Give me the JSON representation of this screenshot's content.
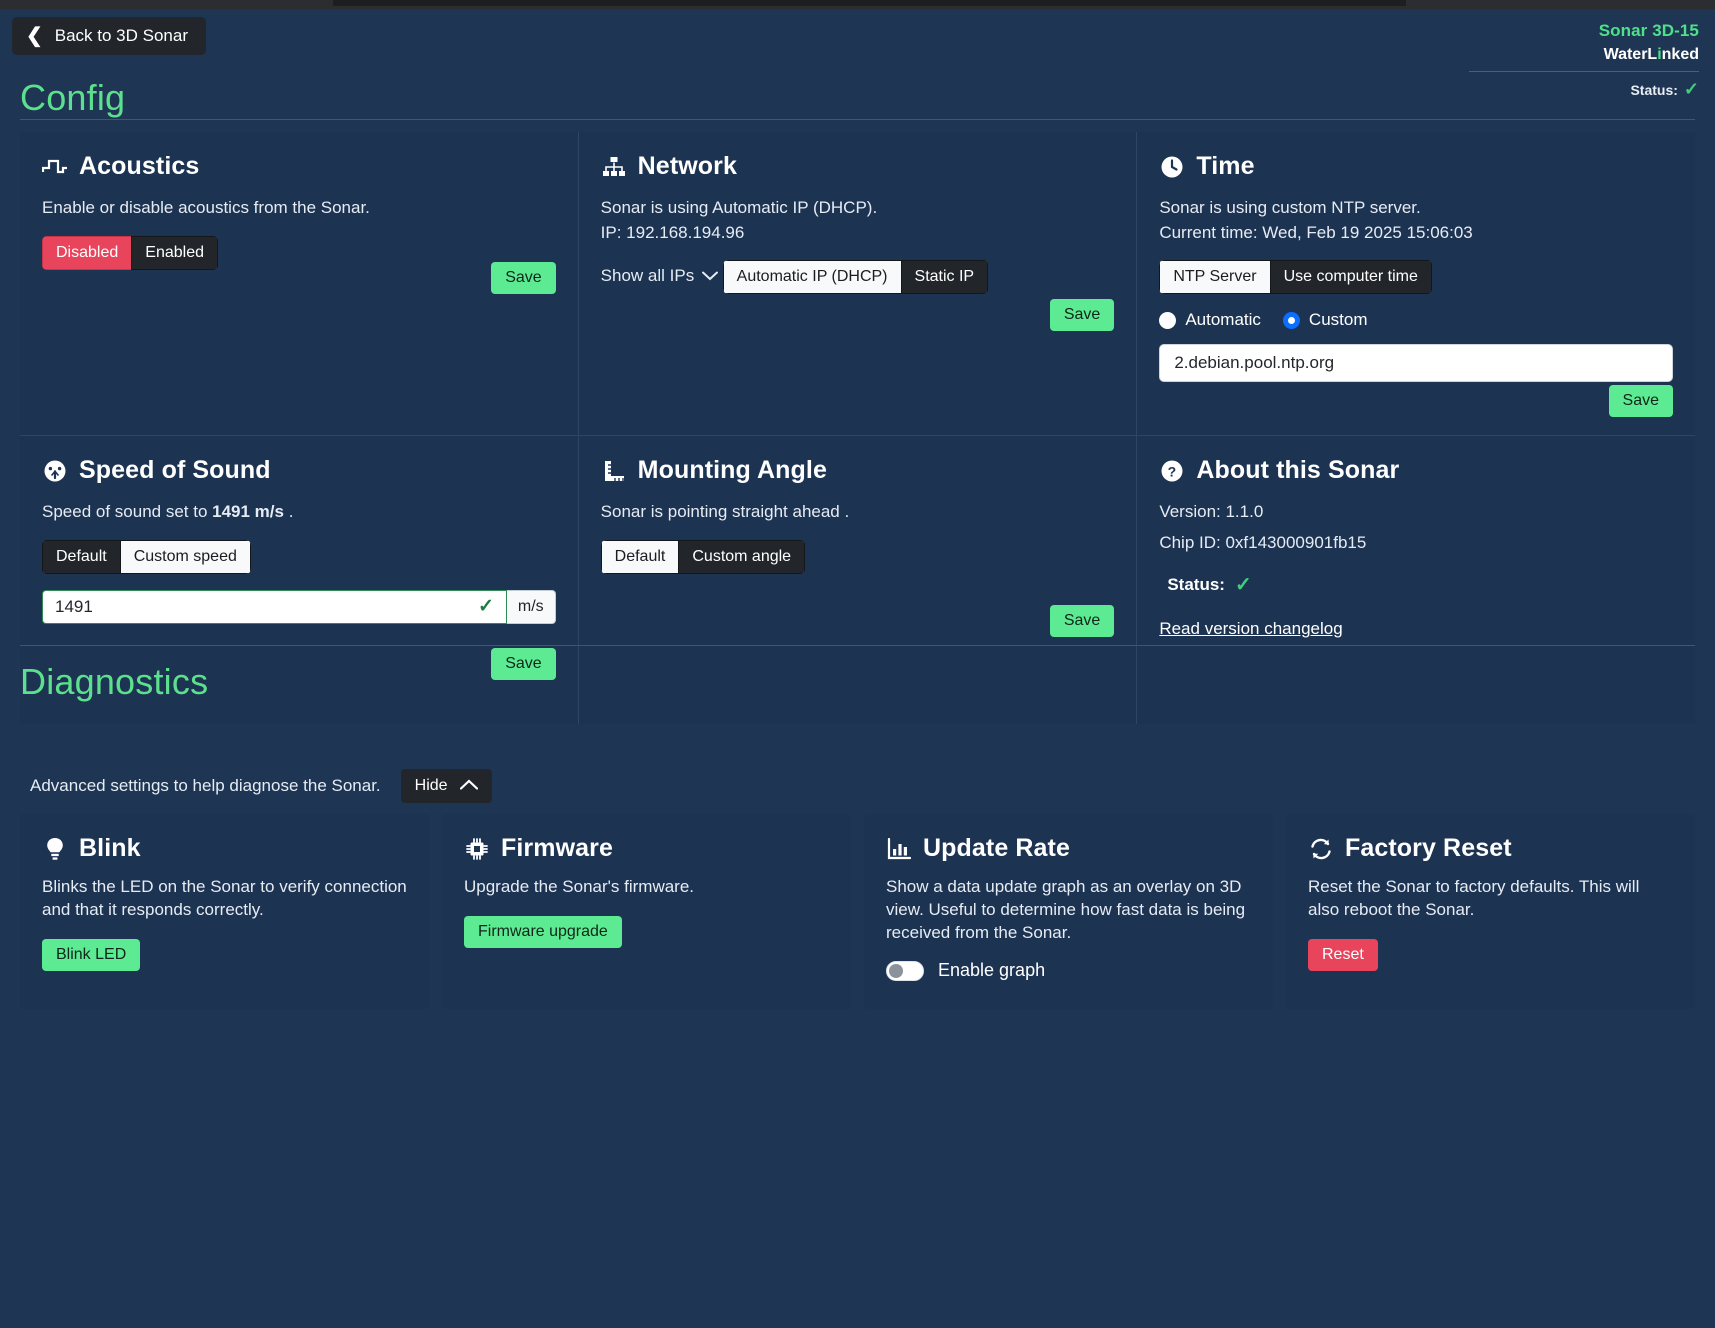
{
  "header": {
    "back_label": "Back to 3D Sonar",
    "back_icon": "chevron-left-icon",
    "model": "Sonar 3D-15",
    "brand_pre": "WaterL",
    "brand_dot": "i",
    "brand_post": "nked",
    "status_label": "Status:",
    "status_icon": "check-icon"
  },
  "sections": {
    "config_title": "Config",
    "diagnostics_title": "Diagnostics",
    "diagnostics_desc": "Advanced settings to help diagnose the Sonar.",
    "hide_label": "Hide",
    "hide_icon": "chevron-up-icon"
  },
  "acoustics": {
    "title": "Acoustics",
    "icon": "pulse-wave-icon",
    "desc": "Enable or disable acoustics from the Sonar.",
    "options": [
      "Disabled",
      "Enabled"
    ],
    "selected": "Disabled",
    "save_label": "Save"
  },
  "network": {
    "title": "Network",
    "icon": "network-nodes-icon",
    "desc": "Sonar is using Automatic IP (DHCP).",
    "ip_line": "IP: 192.168.194.96",
    "show_all_ips": "Show all IPs",
    "show_all_icon": "chevron-down-icon",
    "options": [
      "Automatic IP (DHCP)",
      "Static IP"
    ],
    "selected": "Automatic IP (DHCP)",
    "save_label": "Save"
  },
  "time": {
    "title": "Time",
    "icon": "clock-icon",
    "desc": "Sonar is using custom NTP server.",
    "current_time": "Current time: Wed, Feb 19 2025 15:06:03",
    "options": [
      "NTP Server",
      "Use computer time"
    ],
    "selected": "NTP Server",
    "radios": [
      "Automatic",
      "Custom"
    ],
    "radio_selected": "Custom",
    "ntp_value": "2.debian.pool.ntp.org",
    "save_label": "Save"
  },
  "speed_of_sound": {
    "title": "Speed of Sound",
    "icon": "gauge-icon",
    "desc_pre": "Speed of sound set to ",
    "desc_value": "1491 m/s",
    "desc_post": " .",
    "options": [
      "Default",
      "Custom speed"
    ],
    "selected": "Custom speed",
    "input_value": "1491",
    "valid_icon": "check-icon",
    "unit": "m/s",
    "save_label": "Save"
  },
  "mounting_angle": {
    "title": "Mounting Angle",
    "icon": "ruler-icon",
    "desc": "Sonar is pointing straight ahead .",
    "options": [
      "Default",
      "Custom angle"
    ],
    "selected": "Default",
    "save_label": "Save"
  },
  "about": {
    "title": "About this Sonar",
    "icon": "question-circle-icon",
    "version": "Version: 1.1.0",
    "chip_id": "Chip ID: 0xf143000901fb15",
    "status_label": "Status:",
    "status_icon": "check-icon",
    "changelog_link": "Read version changelog"
  },
  "blink": {
    "title": "Blink",
    "icon": "lightbulb-icon",
    "desc": "Blinks the LED on the Sonar to verify connection and that it responds correctly.",
    "button": "Blink LED"
  },
  "firmware": {
    "title": "Firmware",
    "icon": "microchip-icon",
    "desc": "Upgrade the Sonar's firmware.",
    "button": "Firmware upgrade"
  },
  "update_rate": {
    "title": "Update Rate",
    "icon": "bar-chart-icon",
    "desc": "Show a data update graph as an overlay on 3D view. Useful to determine how fast data is being received from the Sonar.",
    "toggle_label": "Enable graph",
    "toggle_on": false
  },
  "factory_reset": {
    "title": "Factory Reset",
    "icon": "refresh-icon",
    "desc": "Reset the Sonar to factory defaults. This will also reboot the Sonar.",
    "button": "Reset"
  },
  "colors": {
    "background": "#1e3553",
    "card": "#1d3352",
    "accent_green": "#5de08d",
    "button_green": "#5ceb92",
    "danger_red": "#e8455c",
    "dark": "#22262b",
    "radio_blue": "#0d6efd"
  }
}
